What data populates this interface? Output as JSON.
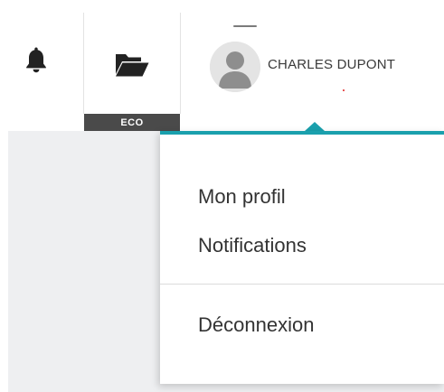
{
  "header": {
    "icons": {
      "bell": "bell-icon",
      "folder": "folder-open-icon",
      "avatar": "user-avatar-icon"
    },
    "folder_badge": "ECO",
    "user": {
      "name": "CHARLES DUPONT"
    }
  },
  "dropdown": {
    "items": [
      {
        "label": "Mon profil"
      },
      {
        "label": "Notifications"
      },
      {
        "label": "Déconnexion"
      }
    ]
  },
  "colors": {
    "accent": "#1aa0ad",
    "badge_bg": "#4a4a4a",
    "content_bg": "#eeeff1"
  }
}
